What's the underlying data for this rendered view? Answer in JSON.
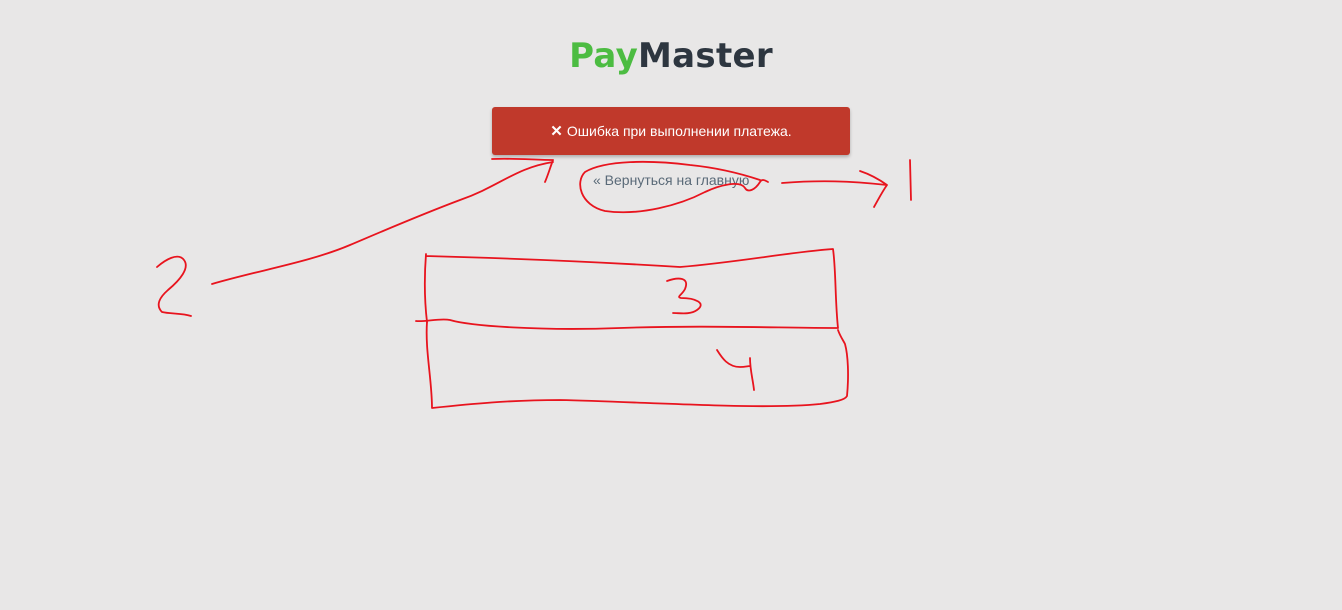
{
  "logo": {
    "part1": "Pay",
    "part2": "Master",
    "color_part1": "#4cbc42",
    "color_part2": "#2d3640"
  },
  "error": {
    "icon": "close-icon",
    "icon_glyph": "✕",
    "message": "Ошибка при выполнении платежа.",
    "background": "#c0392b"
  },
  "back_link": {
    "label": "« Вернуться на главную"
  },
  "annotation_marks": {
    "color": "#e8141e",
    "labels": [
      "1",
      "2",
      "3",
      "4"
    ]
  }
}
